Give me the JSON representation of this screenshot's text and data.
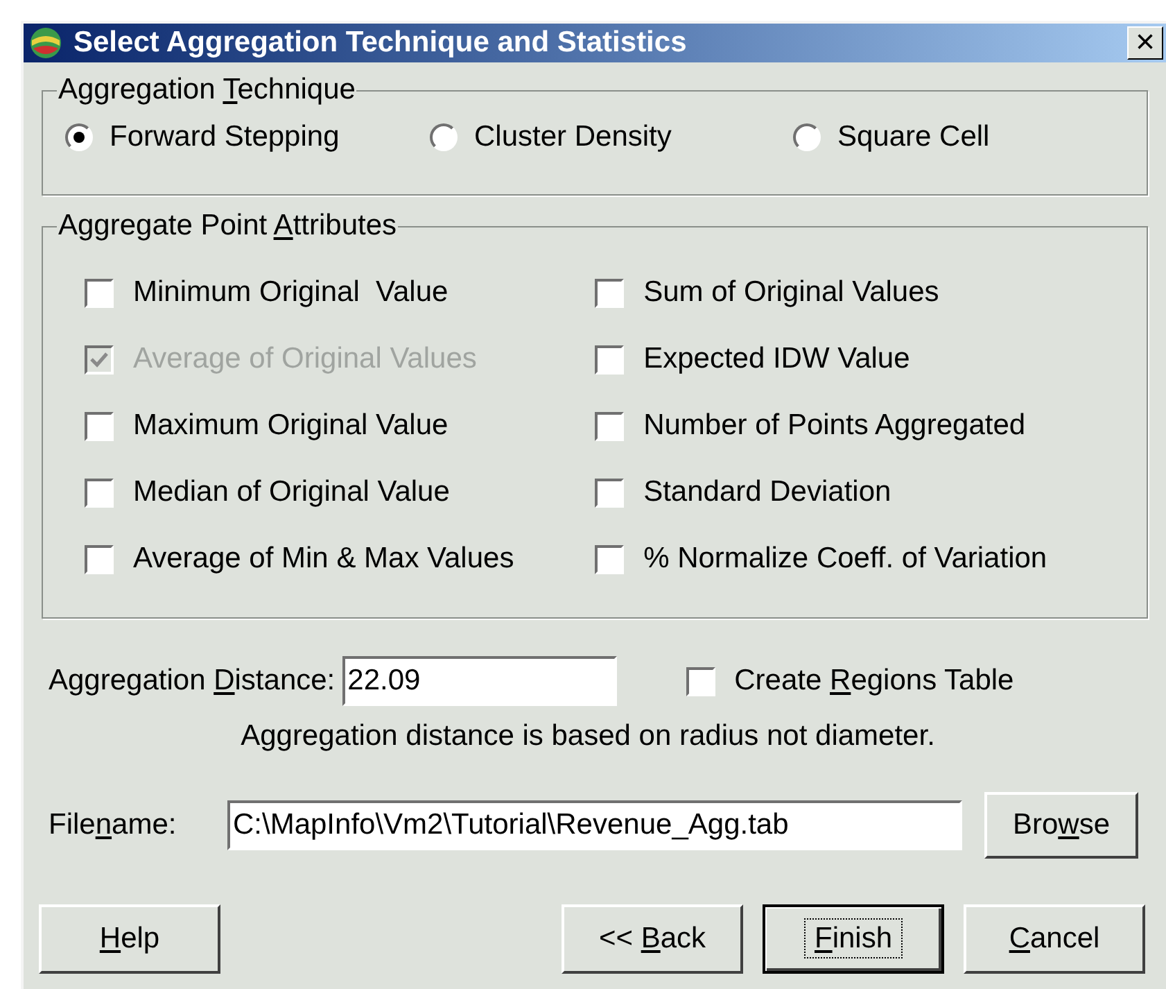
{
  "window": {
    "title": "Select Aggregation Technique and Statistics",
    "close": "×"
  },
  "technique": {
    "legend": {
      "before": "Aggregation ",
      "key": "T",
      "after": "echnique"
    },
    "options": [
      {
        "label": "Forward Stepping",
        "selected": true
      },
      {
        "label": "Cluster Density",
        "selected": false
      },
      {
        "label": "Square Cell",
        "selected": false
      }
    ]
  },
  "attributes": {
    "legend": {
      "before": "Aggregate Point ",
      "key": "A",
      "after": "ttributes"
    },
    "columns": [
      [
        {
          "label": "Minimum Original  Value",
          "checked": false,
          "disabled": false
        },
        {
          "label": "Average of Original Values",
          "checked": true,
          "disabled": true
        },
        {
          "label": "Maximum Original Value",
          "checked": false,
          "disabled": false
        },
        {
          "label": "Median of Original Value",
          "checked": false,
          "disabled": false
        },
        {
          "label": "Average of Min & Max Values",
          "checked": false,
          "disabled": false
        }
      ],
      [
        {
          "label": "Sum of Original Values",
          "checked": false,
          "disabled": false
        },
        {
          "label": "Expected IDW Value",
          "checked": false,
          "disabled": false
        },
        {
          "label": "Number of Points Aggregated",
          "checked": false,
          "disabled": false
        },
        {
          "label": "Standard Deviation",
          "checked": false,
          "disabled": false
        },
        {
          "label": "% Normalize Coeff. of Variation",
          "checked": false,
          "disabled": false
        }
      ]
    ]
  },
  "distance": {
    "label": {
      "before": "Aggregation ",
      "key": "D",
      "after": "istance:"
    },
    "value": "22.09"
  },
  "regions_table": {
    "label": {
      "before": "Create ",
      "key": "R",
      "after": "egions Table"
    },
    "checked": false
  },
  "note": "Aggregation distance is based on radius not diameter.",
  "filename": {
    "label": {
      "before": "File",
      "key": "n",
      "after": "ame:"
    },
    "value": "C:\\MapInfo\\Vm2\\Tutorial\\Revenue_Agg.tab",
    "browse": {
      "before": "Bro",
      "key": "w",
      "after": "se"
    }
  },
  "buttons": [
    {
      "label": {
        "key": "H",
        "after": "elp"
      },
      "kind": "help",
      "default": false
    },
    {
      "label": {
        "before": "<< ",
        "key": "B",
        "after": "ack"
      },
      "kind": "back",
      "default": false
    },
    {
      "label": {
        "key": "F",
        "after": "inish"
      },
      "kind": "finish",
      "default": true
    },
    {
      "label": {
        "key": "C",
        "after": "ancel"
      },
      "kind": "cancel",
      "default": false
    }
  ]
}
